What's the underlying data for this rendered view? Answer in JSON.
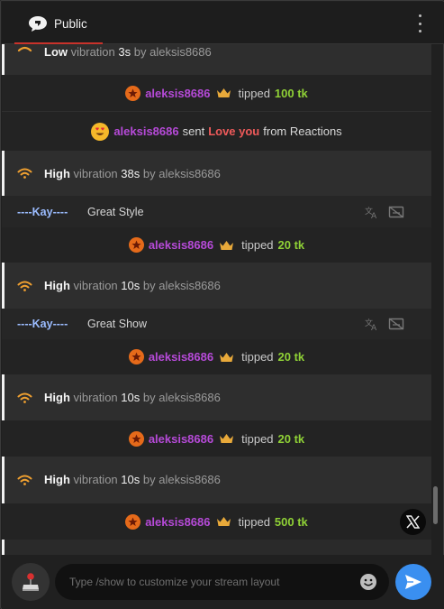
{
  "header": {
    "title": "Public"
  },
  "messages": {
    "vib1": {
      "level": "Low",
      "word": "vibration",
      "duration": "3s",
      "by": "by aleksis8686"
    },
    "tip1": {
      "user": "aleksis8686",
      "action": "tipped",
      "amount": "100 tk"
    },
    "reaction1": {
      "user": "aleksis8686",
      "sent": "sent",
      "item": "Love you",
      "from": "from Reactions"
    },
    "vib2": {
      "level": "High",
      "word": "vibration",
      "duration": "38s",
      "by": "by aleksis8686"
    },
    "chat1": {
      "name": "----Kay----",
      "text": "Great Style"
    },
    "tip2": {
      "user": "aleksis8686",
      "action": "tipped",
      "amount": "20 tk"
    },
    "vib3": {
      "level": "High",
      "word": "vibration",
      "duration": "10s",
      "by": "by aleksis8686"
    },
    "chat2": {
      "name": "----Kay----",
      "text": "Great Show"
    },
    "tip3": {
      "user": "aleksis8686",
      "action": "tipped",
      "amount": "20 tk"
    },
    "vib4": {
      "level": "High",
      "word": "vibration",
      "duration": "10s",
      "by": "by aleksis8686"
    },
    "tip4": {
      "user": "aleksis8686",
      "action": "tipped",
      "amount": "20 tk"
    },
    "vib5": {
      "level": "High",
      "word": "vibration",
      "duration": "10s",
      "by": "by aleksis8686"
    },
    "tip5": {
      "user": "aleksis8686",
      "action": "tipped",
      "amount": "500 tk"
    }
  },
  "footer": {
    "input_placeholder": "Type /show to customize your stream layout",
    "input_value": ""
  },
  "colors": {
    "username": "#b64ad8",
    "amount": "#8fd136",
    "coin": "#e56a1a",
    "vibration_icon": "#f0a030",
    "send_button": "#3a8ff0",
    "tab_underline": "#c8322b"
  },
  "icons": [
    "chat-bubble-icon",
    "more-vertical-icon",
    "vibration-icon",
    "coin-star-icon",
    "crown-icon",
    "heart-eyes-emoji-icon",
    "translate-icon",
    "hide-icon",
    "x-logo-icon",
    "joystick-icon",
    "smiley-icon",
    "send-icon"
  ]
}
